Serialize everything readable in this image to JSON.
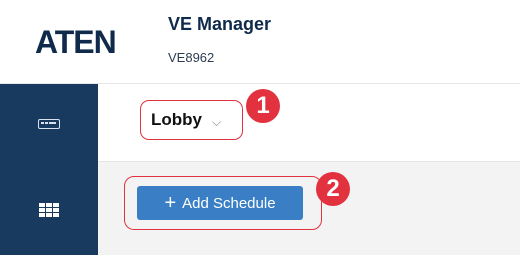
{
  "header": {
    "logo_text": "ATEN",
    "app_title": "VE Manager",
    "app_subtitle": "VE8962"
  },
  "sidebar": {
    "items": [
      {
        "icon": "kvm-device-icon"
      },
      {
        "icon": "grid-layout-icon"
      }
    ]
  },
  "toolbar": {
    "selected_location": "Lobby",
    "chevron": "⌵"
  },
  "content": {
    "add_schedule_label": "Add Schedule",
    "add_plus": "+"
  },
  "callouts": {
    "one": "1",
    "two": "2"
  },
  "colors": {
    "brand_navy": "#173a5e",
    "button_blue": "#3a7fc5",
    "callout_red": "#e3323f"
  }
}
